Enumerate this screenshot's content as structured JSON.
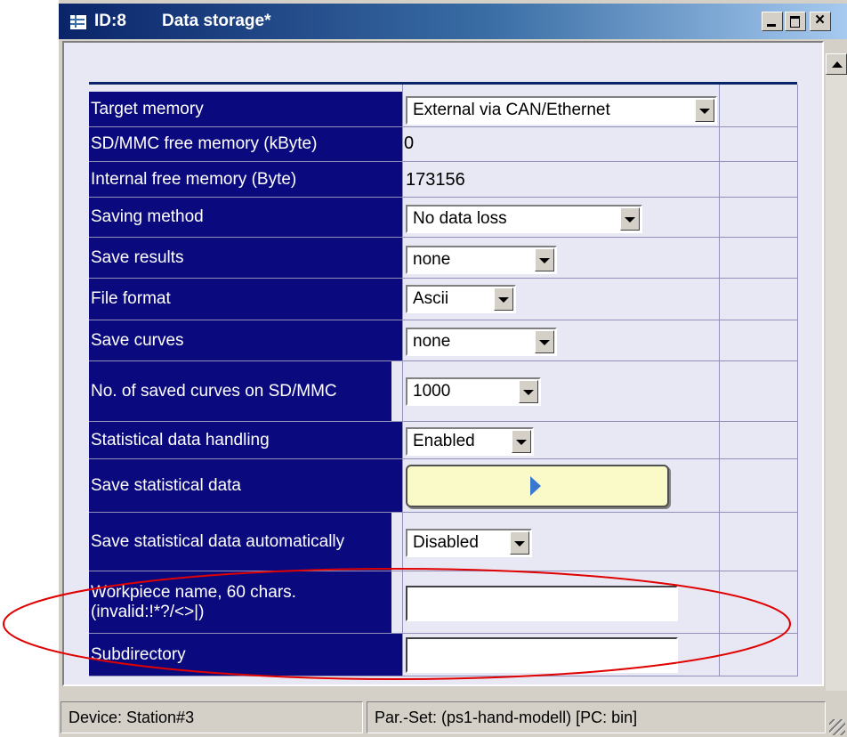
{
  "window": {
    "id_label": "ID:8",
    "title": "Data storage*",
    "controls": [
      "minimize",
      "maximize",
      "close"
    ]
  },
  "rows": [
    {
      "label": "Target memory",
      "kind": "combo",
      "value": "External via CAN/Ethernet"
    },
    {
      "label": "SD/MMC free memory (kByte)",
      "kind": "text",
      "value": "0"
    },
    {
      "label": "Internal free memory (Byte)",
      "kind": "text",
      "value": "173156"
    },
    {
      "label": "Saving method",
      "kind": "combo",
      "value": "No data loss"
    },
    {
      "label": "Save results",
      "kind": "combo",
      "value": "none"
    },
    {
      "label": "File format",
      "kind": "combo",
      "value": "Ascii"
    },
    {
      "label": "Save curves",
      "kind": "combo",
      "value": "none"
    },
    {
      "label": "No. of saved curves on SD/MMC",
      "kind": "combo",
      "value": "1000"
    },
    {
      "label": "Statistical data handling",
      "kind": "combo",
      "value": "Enabled"
    },
    {
      "label": "Save statistical data",
      "kind": "button",
      "value": ""
    },
    {
      "label": "Save statistical data automatically",
      "kind": "combo",
      "value": "Disabled"
    },
    {
      "label": "Workpiece name, 60 chars. (invalid:!*?/<>|)",
      "kind": "input",
      "value": ""
    },
    {
      "label": "Subdirectory",
      "kind": "input",
      "value": ""
    }
  ],
  "status": {
    "device": "Device: Station#3",
    "parset": "Par.-Set:  (ps1-hand-modell) [PC: bin]"
  },
  "colors": {
    "label_bg": "#0a0a7e",
    "annotation": "#e00000",
    "button_fill": "#fafac8"
  }
}
